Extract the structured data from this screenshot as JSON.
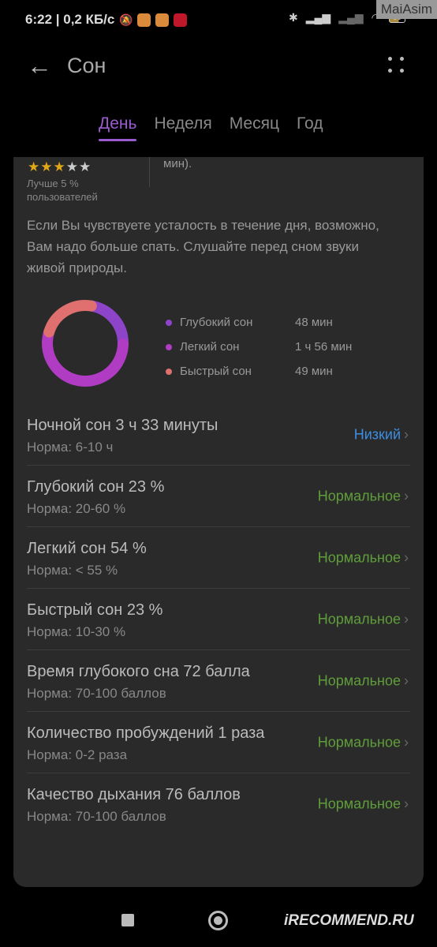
{
  "status": {
    "time": "6:22",
    "speed": "0,2 КБ/с",
    "battery": "60",
    "watermark": "MaiAsim"
  },
  "header": {
    "title": "Сон"
  },
  "tabs": [
    {
      "label": "День",
      "active": true
    },
    {
      "label": "Неделя"
    },
    {
      "label": "Месяц"
    },
    {
      "label": "Год"
    }
  ],
  "summary": {
    "stars": 3,
    "stars_total": 5,
    "better": "Лучше 5 % пользователей",
    "duration_tail": "мин)."
  },
  "advice": "Если Вы чувствуете усталость в течение дня, возможно, Вам надо больше спать. Слушайте перед сном звуки живой природы.",
  "chart_data": {
    "type": "pie",
    "variant": "donut",
    "series": [
      {
        "name": "Глубокий сон",
        "label": "48 мин",
        "minutes": 48,
        "color": "#8e44c9"
      },
      {
        "name": "Легкий сон",
        "label": "1 ч 56 мин",
        "minutes": 116,
        "color": "#b03cc4"
      },
      {
        "name": "Быстрый сон",
        "label": "49 мин",
        "minutes": 49,
        "color": "#e07070"
      }
    ]
  },
  "rows": [
    {
      "title": "Ночной сон  3 ч 33 минуты",
      "norm": "Норма: 6-10 ч",
      "status": "Низкий",
      "color": "#3d8ee0"
    },
    {
      "title": "Глубокий сон  23 %",
      "norm": "Норма: 20-60 %",
      "status": "Нормальное",
      "color": "#5f9e3a"
    },
    {
      "title": "Легкий сон  54 %",
      "norm": "Норма: < 55 %",
      "status": "Нормальное",
      "color": "#5f9e3a"
    },
    {
      "title": "Быстрый сон  23 %",
      "norm": "Норма: 10-30 %",
      "status": "Нормальное",
      "color": "#5f9e3a"
    },
    {
      "title": "Время глубокого сна  72 балла",
      "norm": "Норма: 70-100 баллов",
      "status": "Нормальное",
      "color": "#5f9e3a"
    },
    {
      "title": "Количество пробуждений  1 раза",
      "norm": "Норма: 0-2 раза",
      "status": "Нормальное",
      "color": "#5f9e3a"
    },
    {
      "title": "Качество дыхания  76 баллов",
      "norm": "Норма: 70-100 баллов",
      "status": "Нормальное",
      "color": "#5f9e3a"
    }
  ],
  "footer": {
    "brand": "iRECOMMEND.RU"
  }
}
